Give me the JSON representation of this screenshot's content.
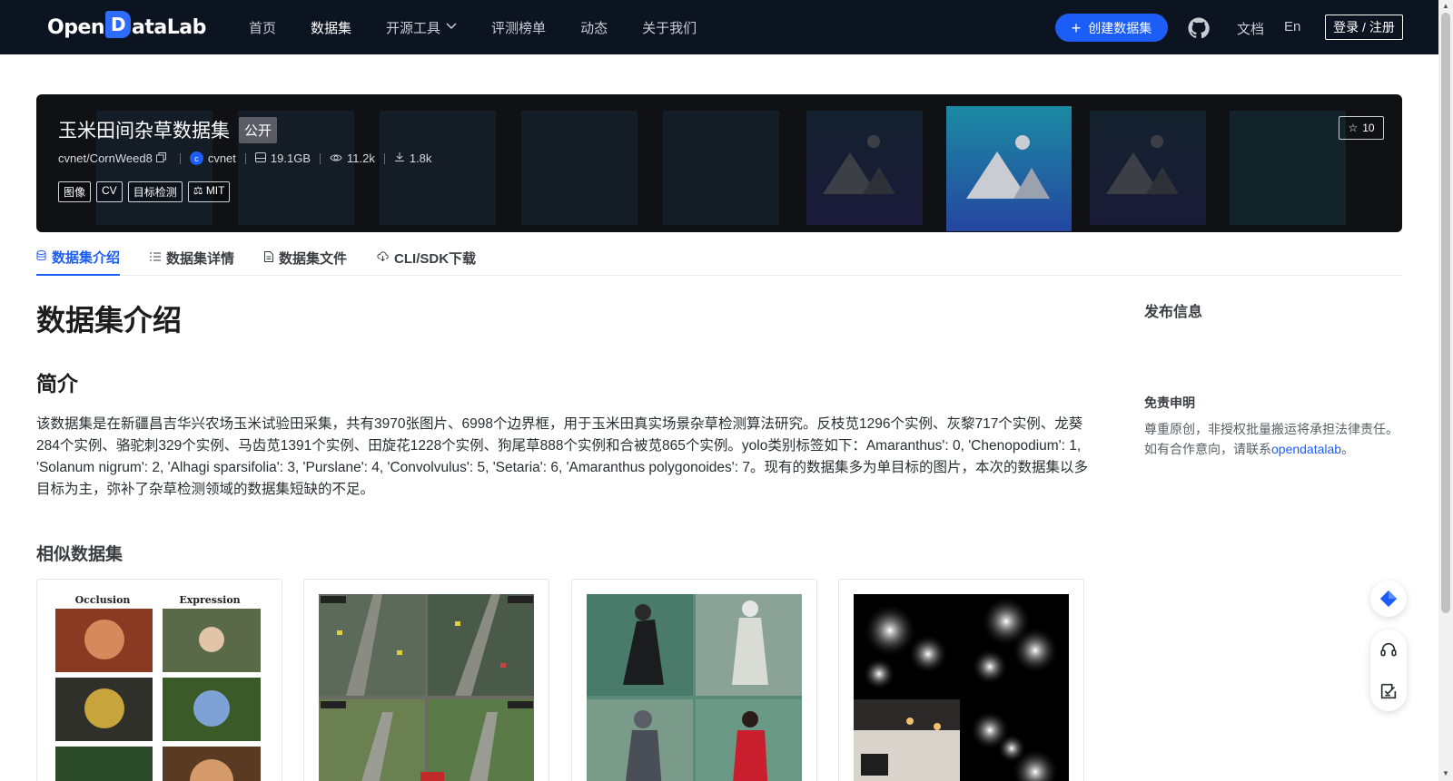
{
  "brand": {
    "logo_left": "Open",
    "logo_d": "D",
    "logo_right": "ataLab"
  },
  "nav": {
    "items": [
      "首页",
      "数据集",
      "开源工具",
      "评测榜单",
      "动态",
      "关于我们"
    ],
    "active_index": 1,
    "create_label": "创建数据集",
    "docs_label": "文档",
    "lang_label": "En",
    "login_label": "登录 / 注册"
  },
  "dataset": {
    "title": "玉米田间杂草数据集",
    "visibility": "公开",
    "repo": "cvnet/CornWeed8",
    "owner": "cvnet",
    "owner_initial": "c",
    "size": "19.1GB",
    "views": "11.2k",
    "downloads": "1.8k",
    "tags": [
      "图像",
      "CV",
      "目标检测",
      "MIT"
    ],
    "stars": "10"
  },
  "tabs": [
    "数据集介绍",
    "数据集详情",
    "数据集文件",
    "CLI/SDK下载"
  ],
  "content": {
    "heading": "数据集介绍",
    "intro_heading": "简介",
    "intro_text": "该数据集是在新疆昌吉华兴农场玉米试验田采集，共有3970张图片、6998个边界框，用于玉米田真实场景杂草检测算法研究。反枝苋1296个实例、灰黎717个实例、龙葵284个实例、骆驼刺329个实例、马齿苋1391个实例、田旋花1228个实例、狗尾草888个实例和合被苋865个实例。yolo类别标签如下：Amaranthus': 0, 'Chenopodium': 1, 'Solanum nigrum': 2, 'Alhagi sparsifolia': 3, 'Purslane': 4, 'Convolvulus': 5, 'Setaria': 6, 'Amaranthus polygonoides': 7。现有的数据集多为单目标的图片，本次的数据集以多目标为主，弥补了杂草检测领域的数据集短缺的不足。",
    "similar_heading": "相似数据集",
    "card1_labels": [
      "Occlusion",
      "Expression"
    ]
  },
  "sidebar": {
    "publish_title": "发布信息",
    "disclaimer_title": "免责申明",
    "disclaimer_text": "尊重原创，非授权批量搬运将承担法律责任。如有合作意向，请联系",
    "disclaimer_link": "opendatalab",
    "disclaimer_end": "。"
  },
  "colors": {
    "accent": "#1c5df5",
    "nav_bg": "#0d1421",
    "banner_bg": "#0f1114"
  }
}
